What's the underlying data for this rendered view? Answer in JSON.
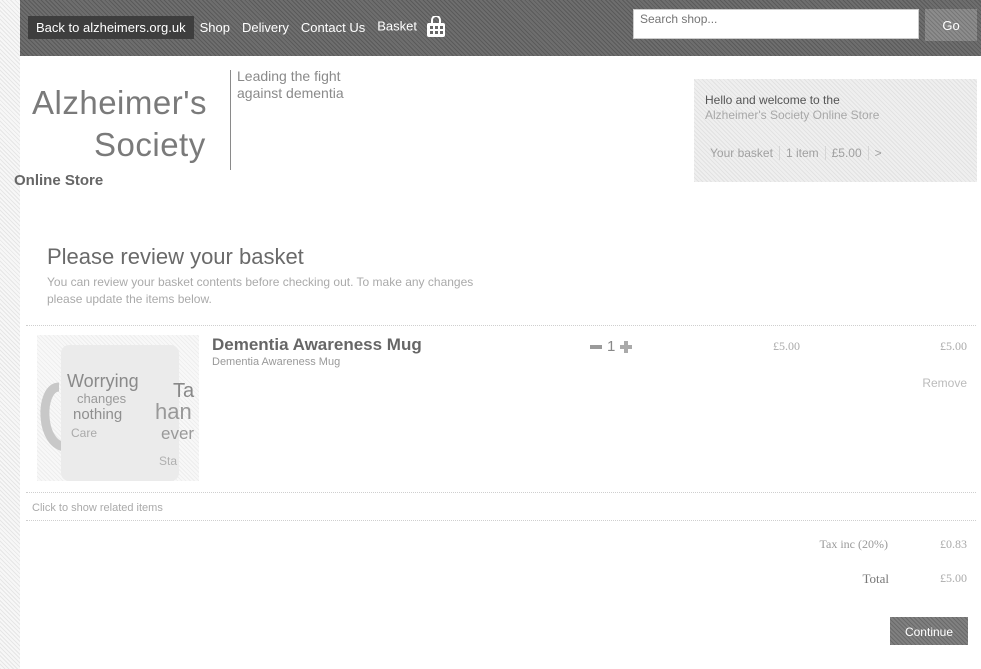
{
  "nav": {
    "back_label": "Back to alzheimers.org.uk",
    "shop_label": "Shop",
    "delivery_label": "Delivery",
    "contact_label": "Contact Us",
    "basket_label": "Basket"
  },
  "search": {
    "placeholder": "Search shop...",
    "go_label": "Go"
  },
  "logo": {
    "name_line1": "Alzheimer's",
    "name_line2": "Society",
    "tagline": "Leading the fight against dementia",
    "store_label": "Online Store"
  },
  "welcome": {
    "line1": "Hello and welcome to the",
    "line2": "Alzheimer's Society Online Store",
    "basket_label": "Your basket",
    "item_count": "1 item",
    "total": "£5.00",
    "arrow": ">"
  },
  "page": {
    "title": "Please review your basket",
    "intro": "You can review your basket contents before checking out. To make any changes please update the items below."
  },
  "item": {
    "title": "Dementia Awareness Mug",
    "subtitle": "Dementia Awareness Mug",
    "quantity": "1",
    "unit_price": "£5.00",
    "line_total": "£5.00",
    "remove_label": "Remove",
    "image_words": [
      "Worrying",
      "changes",
      "nothing",
      "Ta",
      "han",
      "ever",
      "Care",
      "Sta"
    ]
  },
  "related_label": "Click to show related items",
  "totals": {
    "tax_label": "Tax inc (20%)",
    "tax_value": "£0.83",
    "total_label": "Total",
    "total_value": "£5.00"
  },
  "continue_label": "Continue"
}
